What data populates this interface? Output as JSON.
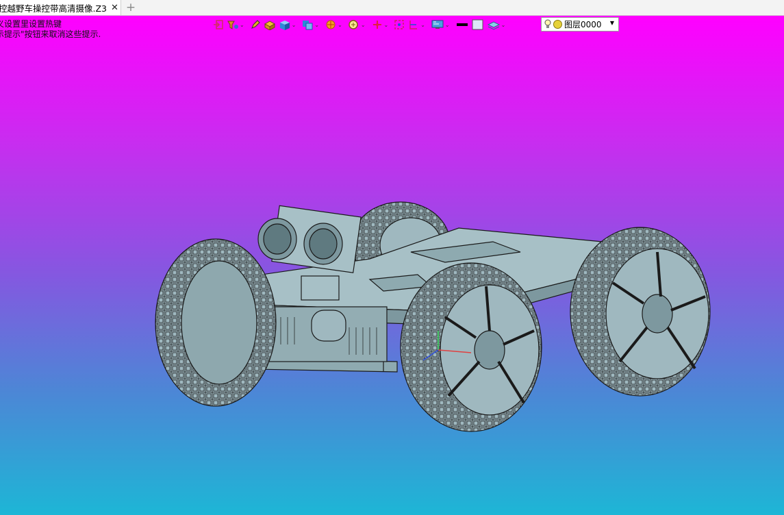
{
  "tab": {
    "title": "控越野车操控带高清摄像.Z3",
    "close_glyph": "✕",
    "new_glyph": "+"
  },
  "hint": {
    "line1": "义设置里设置热键",
    "line2": "示提示\"按钮来取消这些提示."
  },
  "toolbar": {
    "buttons": [
      "exit-icon",
      "filter-icon",
      "pencil-icon",
      "box-fill-icon",
      "cube-icon",
      "view-cube-icon",
      "sun-icon",
      "zoom-icon",
      "move-icon",
      "frame-icon",
      "section-icon",
      "display-icon",
      "line-color-icon",
      "face-color-icon",
      "layer-icon"
    ]
  },
  "layer": {
    "value": "图层0000"
  },
  "colors": {
    "gradient_top": "#ff00ff",
    "gradient_bottom": "#1db6d6",
    "model_fill": "#9fb8bf",
    "model_line": "#1a1a1a"
  }
}
